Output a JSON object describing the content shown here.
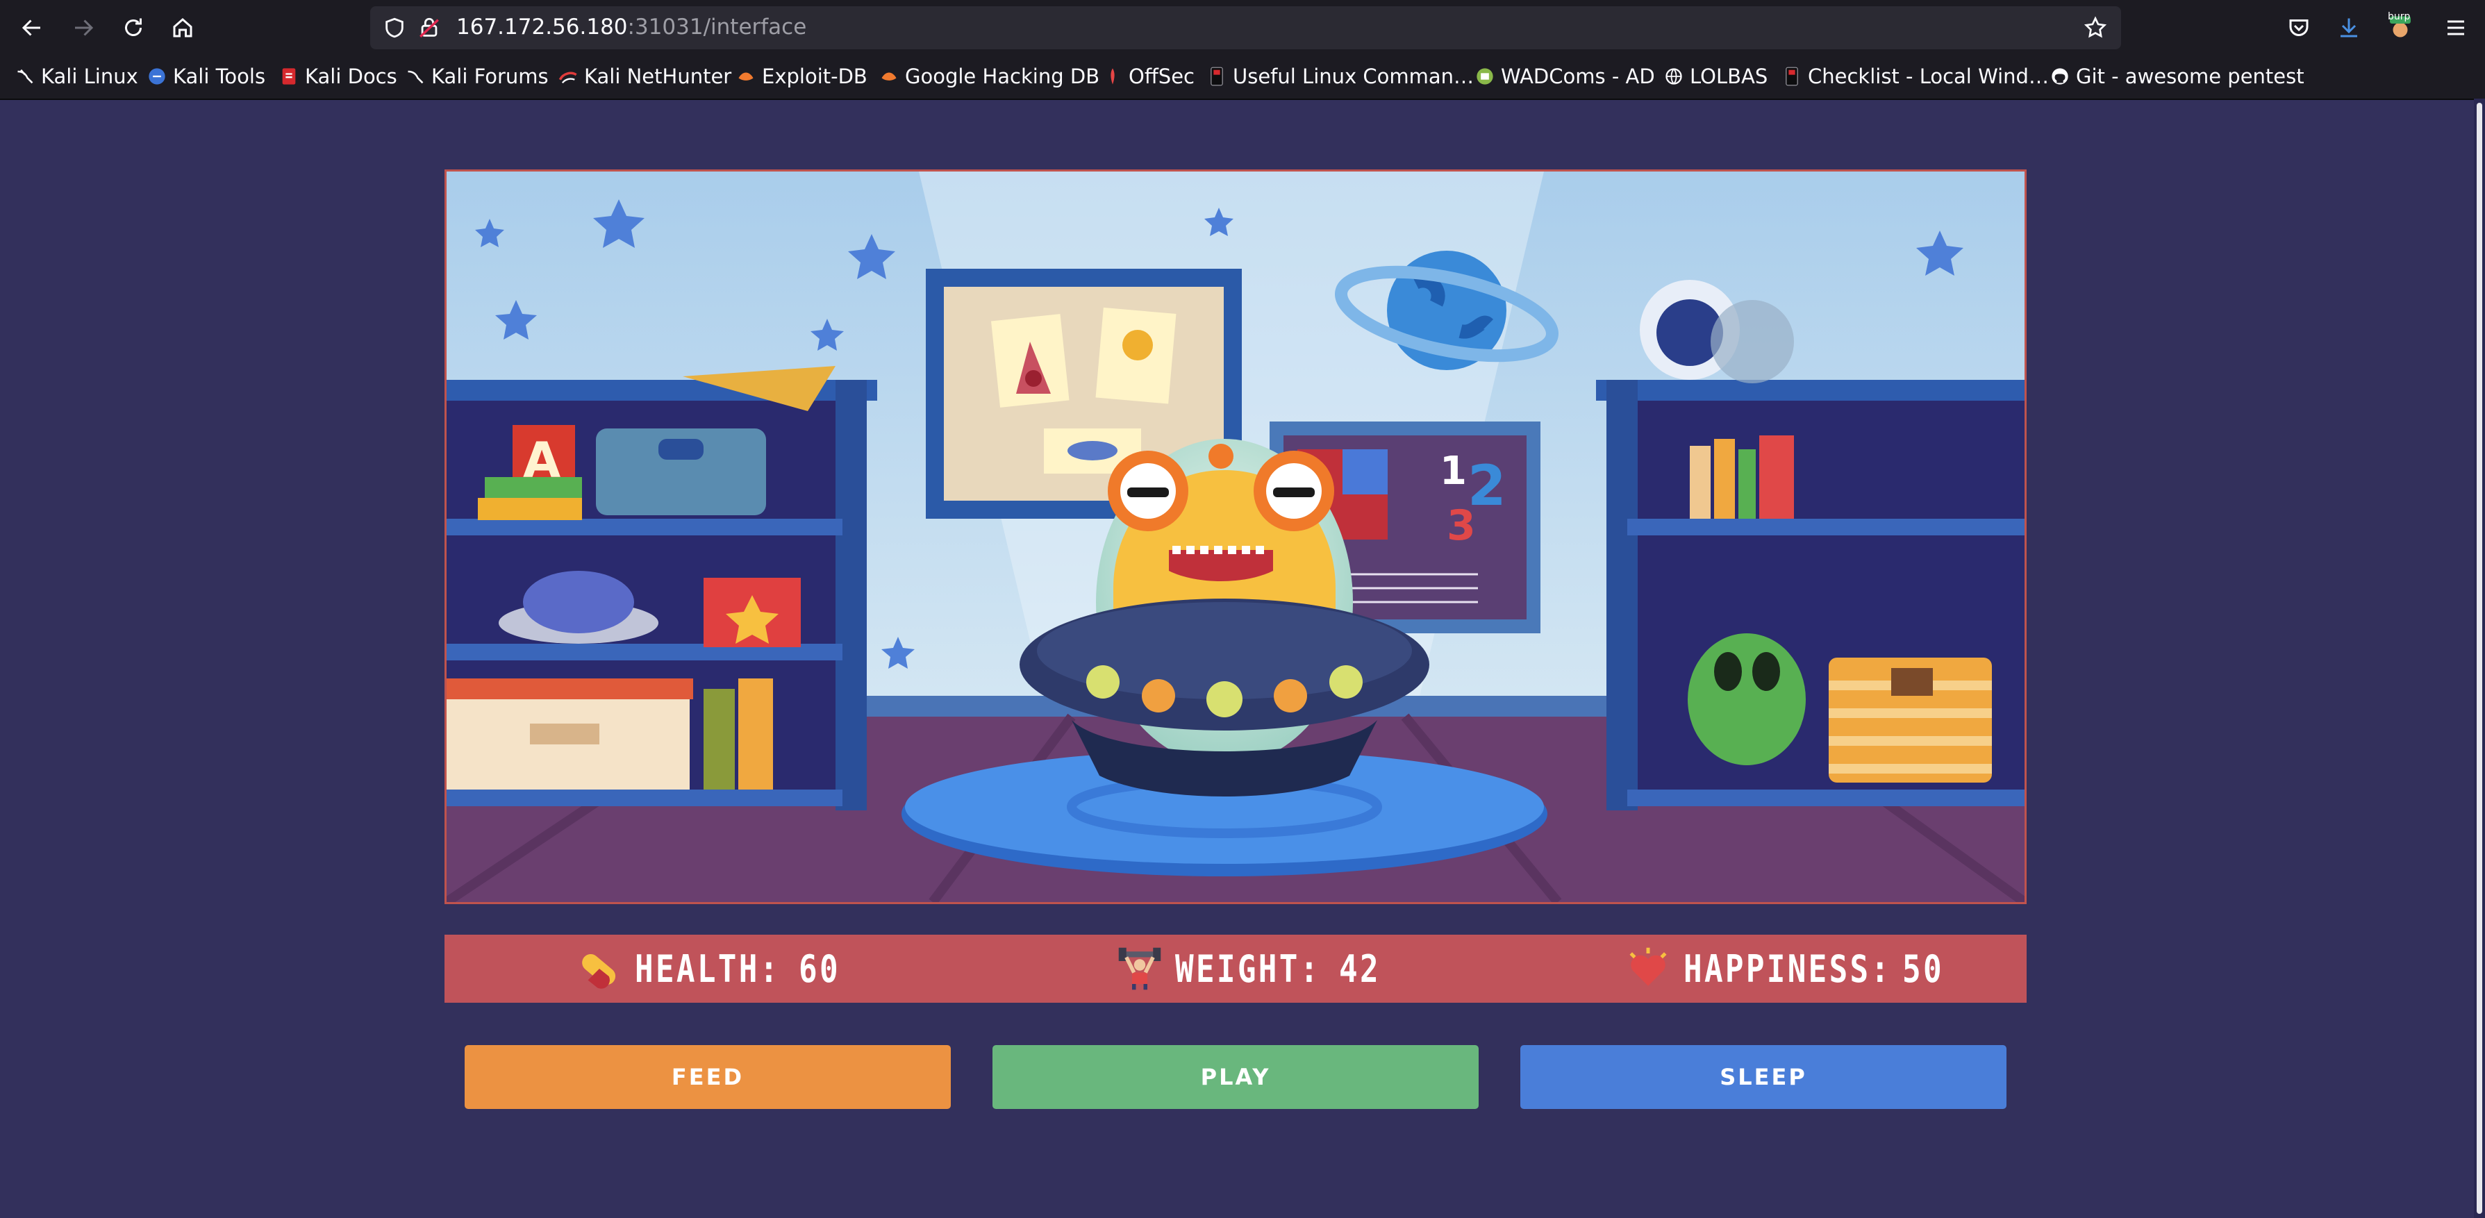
{
  "browser": {
    "url_host": "167.172.56.180",
    "url_path": ":31031/interface",
    "burp_badge": "burp",
    "bookmarks": [
      {
        "label": "Kali Linux",
        "icon": "kali-dragon-icon"
      },
      {
        "label": "Kali Tools",
        "icon": "kali-tools-icon"
      },
      {
        "label": "Kali Docs",
        "icon": "kali-docs-icon"
      },
      {
        "label": "Kali Forums",
        "icon": "kali-forums-icon"
      },
      {
        "label": "Kali NetHunter",
        "icon": "nethunter-icon"
      },
      {
        "label": "Exploit-DB",
        "icon": "exploit-db-icon"
      },
      {
        "label": "Google Hacking DB",
        "icon": "ghdb-icon"
      },
      {
        "label": "OffSec",
        "icon": "offsec-icon"
      },
      {
        "label": "Useful Linux Comman…",
        "icon": "terminal-icon"
      },
      {
        "label": "WADComs - AD",
        "icon": "wadcoms-icon"
      },
      {
        "label": "LOLBAS",
        "icon": "globe-icon"
      },
      {
        "label": "Checklist - Local Wind…",
        "icon": "terminal-icon"
      },
      {
        "label": "Git - awesome pentest",
        "icon": "github-icon"
      }
    ]
  },
  "scene": {
    "pictures": [
      "A",
      "1",
      "2",
      "3"
    ]
  },
  "stats": {
    "health": {
      "label": "HEALTH:",
      "value": "60",
      "icon": "pill-icon"
    },
    "weight": {
      "label": "WEIGHT:",
      "value": "42",
      "icon": "weightlifter-icon"
    },
    "happiness": {
      "label": "HAPPINESS:",
      "value": "50",
      "icon": "heart-icon"
    }
  },
  "actions": {
    "feed": "FEED",
    "play": "PLAY",
    "sleep": "SLEEP"
  },
  "colors": {
    "page_bg": "#33305c",
    "stat_bar": "#c0535a",
    "feed": "#ec9242",
    "play": "#69b77d",
    "sleep": "#4a7ed9"
  }
}
